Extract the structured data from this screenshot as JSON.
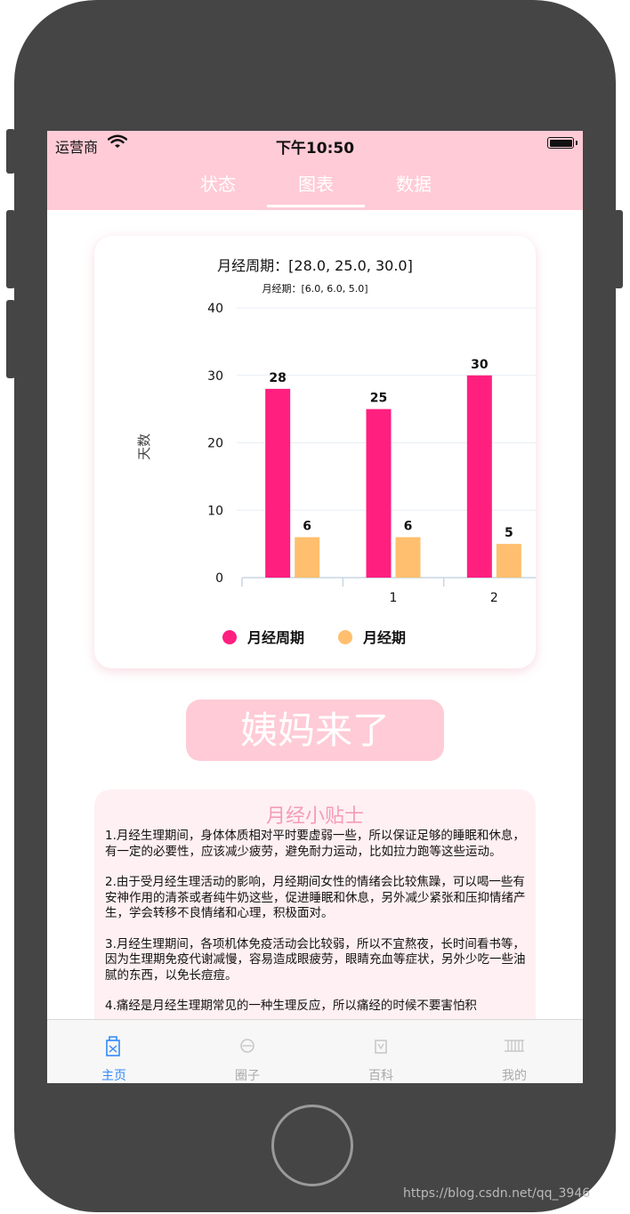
{
  "status_bar": {
    "carrier": "运营商",
    "time": "下午10:50"
  },
  "top_tabs": [
    {
      "label": "状态",
      "active": false
    },
    {
      "label": "图表",
      "active": true
    },
    {
      "label": "数据",
      "active": false
    }
  ],
  "chart_card": {
    "title": "月经周期：[28.0, 25.0, 30.0]",
    "subtitle": "月经期：[6.0, 6.0, 5.0]"
  },
  "chart_data": {
    "type": "bar",
    "categories": [
      "",
      "1",
      "2"
    ],
    "series": [
      {
        "name": "月经周期",
        "values": [
          28,
          25,
          30
        ],
        "color": "#ff1f7f"
      },
      {
        "name": "月经期",
        "values": [
          6,
          6,
          5
        ],
        "color": "#ffbf6e"
      }
    ],
    "ylabel": "天数",
    "ylim": [
      0,
      40
    ],
    "yticks": [
      0,
      10,
      20,
      30,
      40
    ],
    "grid": true,
    "legend": "bottom-center"
  },
  "period_button": {
    "label": "姨妈来了"
  },
  "tips": {
    "title": "月经小贴士",
    "paragraphs": [
      "1.月经生理期间，身体体质相对平时要虚弱一些，所以保证足够的睡眠和休息，有一定的必要性，应该减少疲劳，避免耐力运动，比如拉力跑等这些运动。",
      "2.由于受月经生理活动的影响，月经期间女性的情绪会比较焦躁，可以喝一些有安神作用的清茶或者纯牛奶这些，促进睡眠和休息，另外减少紧张和压抑情绪产生，学会转移不良情绪和心理，积极面对。",
      "3.月经生理期间，各项机体免疫活动会比较弱，所以不宜熬夜，长时间看书等，因为生理期免疫代谢减慢，容易造成眼疲劳，眼睛充血等症状，另外少吃一些油腻的东西，以免长痘痘。",
      "4.痛经是月经生理期常见的一种生理反应，所以痛经的时候不要害怕积"
    ]
  },
  "bottom_tabs": [
    {
      "label": "主页",
      "icon": "home-icon",
      "active": true
    },
    {
      "label": "圈子",
      "icon": "circle-icon",
      "active": false
    },
    {
      "label": "百科",
      "icon": "encyclopedia-icon",
      "active": false
    },
    {
      "label": "我的",
      "icon": "profile-icon",
      "active": false
    }
  ],
  "watermark": "https://blog.csdn.net/qq_3946",
  "colors": {
    "pink_header": "#ffcbd6",
    "accent_blue": "#2f89fc",
    "tips_bg": "#fff0f3",
    "tips_title": "#f59bbb"
  }
}
